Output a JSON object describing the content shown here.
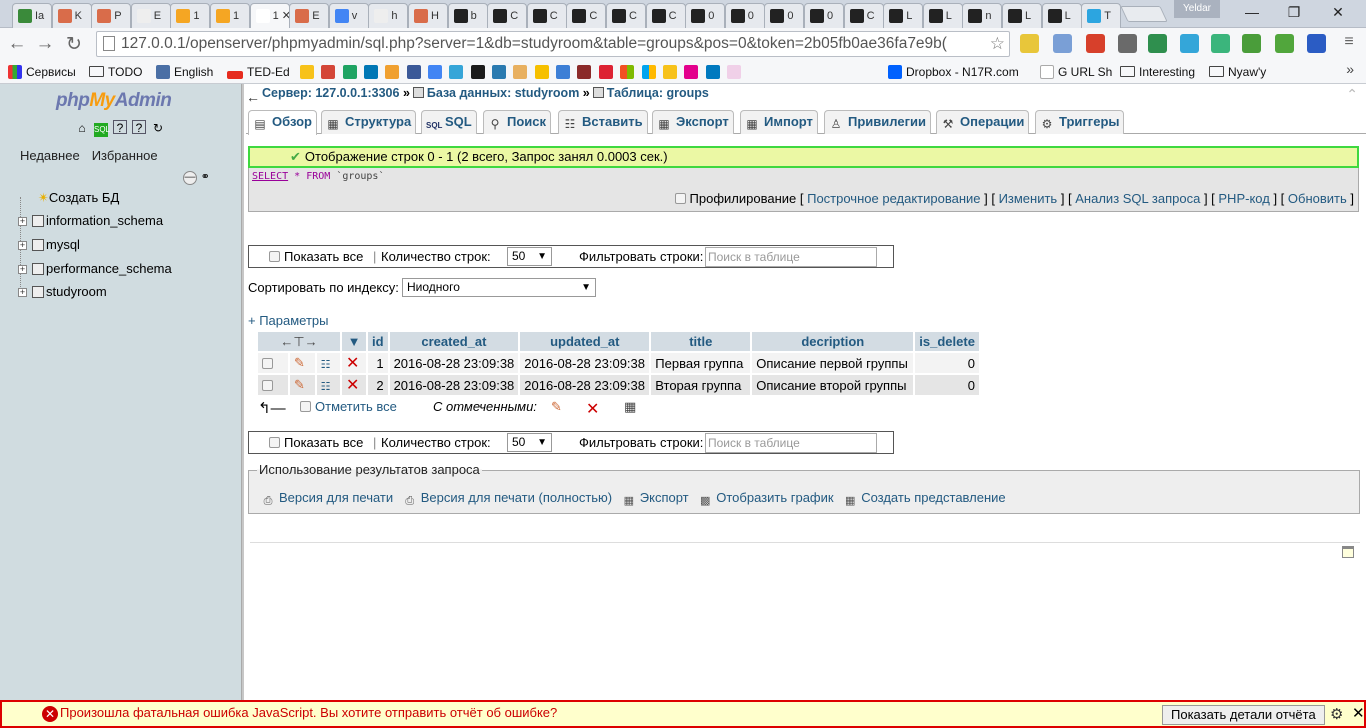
{
  "browser": {
    "tabs": [
      {
        "label": "Ia",
        "color": "#3a8a3a"
      },
      {
        "label": "K",
        "color": "#d96c4a"
      },
      {
        "label": "P",
        "color": "#d96c4a"
      },
      {
        "label": "E",
        "color": "#eeeeee"
      },
      {
        "label": "1",
        "color": "#f5a623"
      },
      {
        "label": "1",
        "color": "#f5a623"
      },
      {
        "label": "1",
        "color": "#ffffff"
      },
      {
        "label": "E",
        "color": "#d96c4a"
      },
      {
        "label": "v",
        "color": "#4285f4"
      },
      {
        "label": "h",
        "color": "#eeeeee"
      },
      {
        "label": "H",
        "color": "#d96c4a"
      },
      {
        "label": "b",
        "color": "#222222"
      },
      {
        "label": "C",
        "color": "#222222"
      },
      {
        "label": "C",
        "color": "#222222"
      },
      {
        "label": "C",
        "color": "#222222"
      },
      {
        "label": "C",
        "color": "#222222"
      },
      {
        "label": "C",
        "color": "#222222"
      },
      {
        "label": "0",
        "color": "#222222"
      },
      {
        "label": "0",
        "color": "#222222"
      },
      {
        "label": "0",
        "color": "#222222"
      },
      {
        "label": "0",
        "color": "#222222"
      },
      {
        "label": "C",
        "color": "#222222"
      },
      {
        "label": "L",
        "color": "#222222"
      },
      {
        "label": "L",
        "color": "#222222"
      },
      {
        "label": "n",
        "color": "#222222"
      },
      {
        "label": "L",
        "color": "#222222"
      },
      {
        "label": "L",
        "color": "#222222"
      },
      {
        "label": "T",
        "color": "#2ca5e0"
      }
    ],
    "user": "Yeldar",
    "url": "127.0.0.1/openserver/phpmyadmin/sql.php?server=1&db=studyroom&table=groups&pos=0&token=2b05fb0ae36fa7e9b(",
    "bookmarks": [
      {
        "label": "Сервисы",
        "icon": "apps-icon"
      },
      {
        "label": "TODO",
        "icon": "folder-icon"
      },
      {
        "label": "English",
        "icon": "et-icon"
      },
      {
        "label": "TED-Ed",
        "icon": "ted-icon"
      },
      {
        "label": "Dropbox - N17R.com",
        "icon": "dropbox-icon"
      },
      {
        "label": "G URL Sh",
        "icon": "google-icon"
      },
      {
        "label": "Interesting",
        "icon": "folder-icon"
      },
      {
        "label": "Nyaw'y",
        "icon": "folder-icon"
      }
    ]
  },
  "sidebar": {
    "logo_php": "php",
    "logo_my": "My",
    "logo_admin": "Admin",
    "recent": "Недавнее",
    "favorites": "Избранное",
    "create_db": "Создать БД",
    "databases": [
      "information_schema",
      "mysql",
      "performance_schema",
      "studyroom"
    ]
  },
  "breadcrumb": {
    "server": "Сервер: 127.0.0.1:3306",
    "database": "База данных: studyroom",
    "table": "Таблица: groups"
  },
  "tabs": [
    {
      "label": "Обзор",
      "icon": "browse-icon"
    },
    {
      "label": "Структура",
      "icon": "structure-icon"
    },
    {
      "label": "SQL",
      "icon": "sql-icon"
    },
    {
      "label": "Поиск",
      "icon": "search-icon"
    },
    {
      "label": "Вставить",
      "icon": "insert-icon"
    },
    {
      "label": "Экспорт",
      "icon": "export-icon"
    },
    {
      "label": "Импорт",
      "icon": "import-icon"
    },
    {
      "label": "Привилегии",
      "icon": "privileges-icon"
    },
    {
      "label": "Операции",
      "icon": "operations-icon"
    },
    {
      "label": "Триггеры",
      "icon": "triggers-icon"
    }
  ],
  "result": {
    "message": "Отображение строк 0 - 1 (2 всего, Запрос занял 0.0003 сек.)",
    "sql_select": "SELECT",
    "sql_rest": "* FROM",
    "sql_table": "`groups`",
    "profiling": "Профилирование",
    "links": {
      "inline_edit": "Построчное редактирование",
      "edit": "Изменить",
      "analyze": "Анализ SQL запроса",
      "php_code": "PHP-код",
      "refresh": "Обновить"
    }
  },
  "navigation": {
    "show_all": "Показать все",
    "rows_label": "Количество строк:",
    "rows_value": "50",
    "filter_label": "Фильтровать строки:",
    "filter_placeholder": "Поиск в таблице"
  },
  "sort": {
    "label": "Сортировать по индексу:",
    "value": "Ниодного"
  },
  "params_link": "+ Параметры",
  "table": {
    "columns": [
      "id",
      "created_at",
      "updated_at",
      "title",
      "decription",
      "is_delete"
    ],
    "rows": [
      [
        "1",
        "2016-08-28 23:09:38",
        "2016-08-28 23:09:38",
        "Первая группа",
        "Описание первой группы",
        "0"
      ],
      [
        "2",
        "2016-08-28 23:09:38",
        "2016-08-28 23:09:38",
        "Вторая группа",
        "Описание второй группы",
        "0"
      ]
    ]
  },
  "bulk": {
    "check_all": "Отметить все",
    "with_selected": "С отмеченными:"
  },
  "usage": {
    "legend": "Использование результатов запроса",
    "print": "Версия для печати",
    "print_full": "Версия для печати (полностью)",
    "export": "Экспорт",
    "chart": "Отобразить график",
    "view": "Создать представление"
  },
  "error_bar": {
    "message": "Произошла фатальная ошибка JavaScript. Вы хотите отправить отчёт об ошибке?",
    "button": "Показать детали отчёта"
  }
}
